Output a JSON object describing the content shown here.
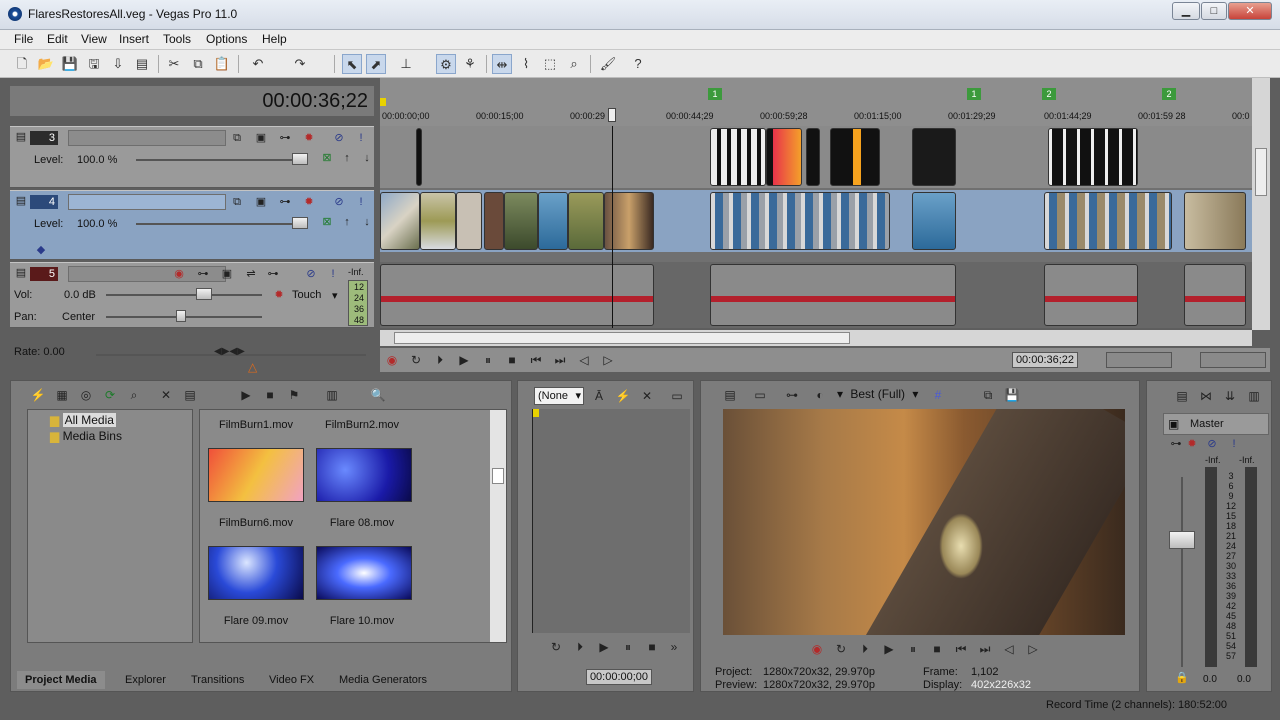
{
  "window": {
    "title": "FlaresRestoresAll.veg - Vegas Pro 11.0",
    "min": "▁",
    "max": "□",
    "close": "✕"
  },
  "menu": [
    "File",
    "Edit",
    "View",
    "Insert",
    "Tools",
    "Options",
    "Help"
  ],
  "timecode": "00:00:36;22",
  "ruler": {
    "ticks": [
      "00:00:00;00",
      "00:00:15;00",
      "00:00:29",
      "00:00:44;29",
      "00:00:59;28",
      "00:01:15;00",
      "00:01:29;29",
      "00:01:44;29",
      "00:01:59 28",
      "00:0"
    ],
    "markers": [
      "1",
      "1",
      "2",
      "2"
    ]
  },
  "tracks": [
    {
      "num": "3",
      "level_label": "Level:",
      "level_value": "100.0 %"
    },
    {
      "num": "4",
      "level_label": "Level:",
      "level_value": "100.0 %"
    },
    {
      "num": "5",
      "vol_label": "Vol:",
      "vol_value": "0.0 dB",
      "pan_label": "Pan:",
      "pan_value": "Center",
      "mode": "Touch",
      "meter_top": "-Inf.",
      "meter_vals": [
        "12",
        "24",
        "36",
        "48"
      ]
    }
  ],
  "rate": {
    "label": "Rate: 0.00"
  },
  "transport_time": "00:00:36;22",
  "media": {
    "tree": [
      "All Media",
      "Media Bins"
    ],
    "thumbs": [
      {
        "label": "FilmBurn1.mov"
      },
      {
        "label": "FilmBurn2.mov"
      },
      {
        "label": "FilmBurn6.mov"
      },
      {
        "label": "Flare 08.mov"
      },
      {
        "label": "Flare 09.mov"
      },
      {
        "label": "Flare 10.mov"
      }
    ],
    "tabs": [
      "Project Media",
      "Explorer",
      "Transitions",
      "Video FX",
      "Media Generators"
    ]
  },
  "trimmer": {
    "dropdown": "(None",
    "time": "00:00:00;00"
  },
  "preview": {
    "quality": "Best (Full)",
    "project_label": "Project:",
    "project_value": "1280x720x32, 29.970p",
    "preview_label": "Preview:",
    "preview_value": "1280x720x32, 29.970p",
    "frame_label": "Frame:",
    "frame_value": "1,102",
    "display_label": "Display:",
    "display_value": "402x226x32"
  },
  "master": {
    "label": "Master",
    "left_top": "-Inf.",
    "right_top": "-Inf.",
    "scale": [
      "3",
      "6",
      "9",
      "12",
      "15",
      "18",
      "21",
      "24",
      "27",
      "30",
      "33",
      "36",
      "39",
      "42",
      "45",
      "48",
      "51",
      "54",
      "57"
    ],
    "left_val": "0.0",
    "right_val": "0.0"
  },
  "status": "Record Time (2 channels): 180:52:00",
  "colors": {
    "accent": "#8aa3c2",
    "clip_red": "#b3202c",
    "marker_green": "#3c9a3c"
  }
}
